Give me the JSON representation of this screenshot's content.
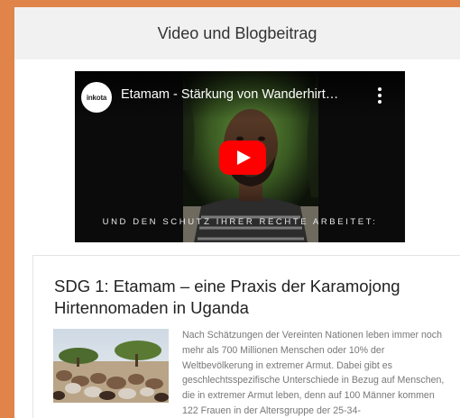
{
  "section": {
    "title": "Video und Blogbeitrag"
  },
  "video": {
    "channel_logo_text": "inkota",
    "title": "Etamam - Stärkung von Wanderhirt…",
    "caption": "UND DEN SCHUTZ IHRER RECHTE ARBEITET:",
    "play_color": "#ff0000"
  },
  "post": {
    "title": "SDG 1: Etamam – eine Praxis der Karamojong Hirtennomaden in Uganda",
    "excerpt": "Nach Schätzungen der Vereinten Nationen leben immer noch mehr als 700 Millionen Menschen oder 10% der Weltbevölkerung in extremer Armut. Dabei gibt es geschlechtsspezifische Unterschiede in Bezug auf Menschen, die in extremer Armut leben, denn auf 100 Männer kommen 122 Frauen in der Altersgruppe der 25-34-"
  },
  "colors": {
    "page_bg": "#e0844a",
    "header_bg": "#f1f1f1"
  }
}
